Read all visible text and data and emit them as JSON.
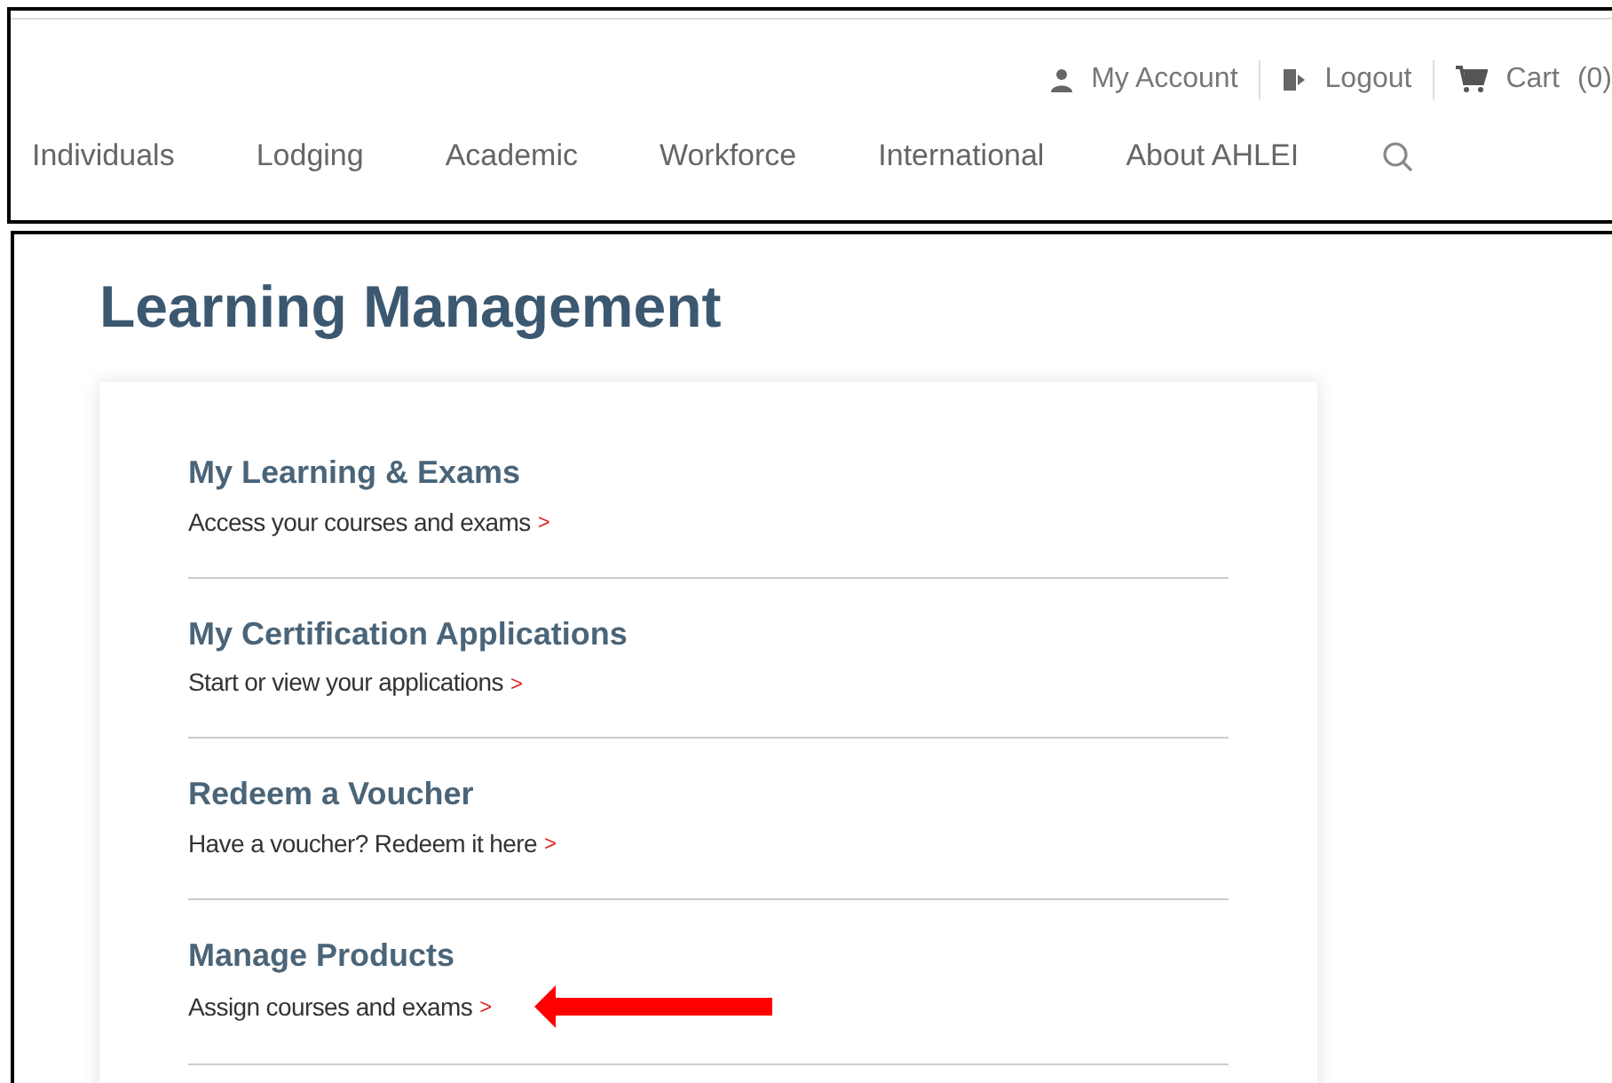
{
  "utility_links": [
    {
      "kind": "account",
      "label": "My Account"
    },
    {
      "kind": "logout",
      "label": "Logout"
    },
    {
      "kind": "cart",
      "label": "Cart",
      "count": "(0)"
    }
  ],
  "nav": [
    "Individuals",
    "Lodging",
    "Academic",
    "Workforce",
    "International",
    "About AHLEI"
  ],
  "heading": "Learning Management",
  "items": [
    {
      "title": "My Learning & Exams",
      "subtitle": "Access your courses and exams",
      "chevron": ">",
      "highlighted": false
    },
    {
      "title": "My Certification Applications",
      "subtitle": "Start or view your applications",
      "chevron": ">",
      "highlighted": false
    },
    {
      "title": "Redeem a Voucher",
      "subtitle": "Have a voucher? Redeem it here",
      "chevron": ">",
      "highlighted": false
    },
    {
      "title": "Manage Products",
      "subtitle": "Assign courses and exams",
      "chevron": ">",
      "highlighted": true
    }
  ]
}
